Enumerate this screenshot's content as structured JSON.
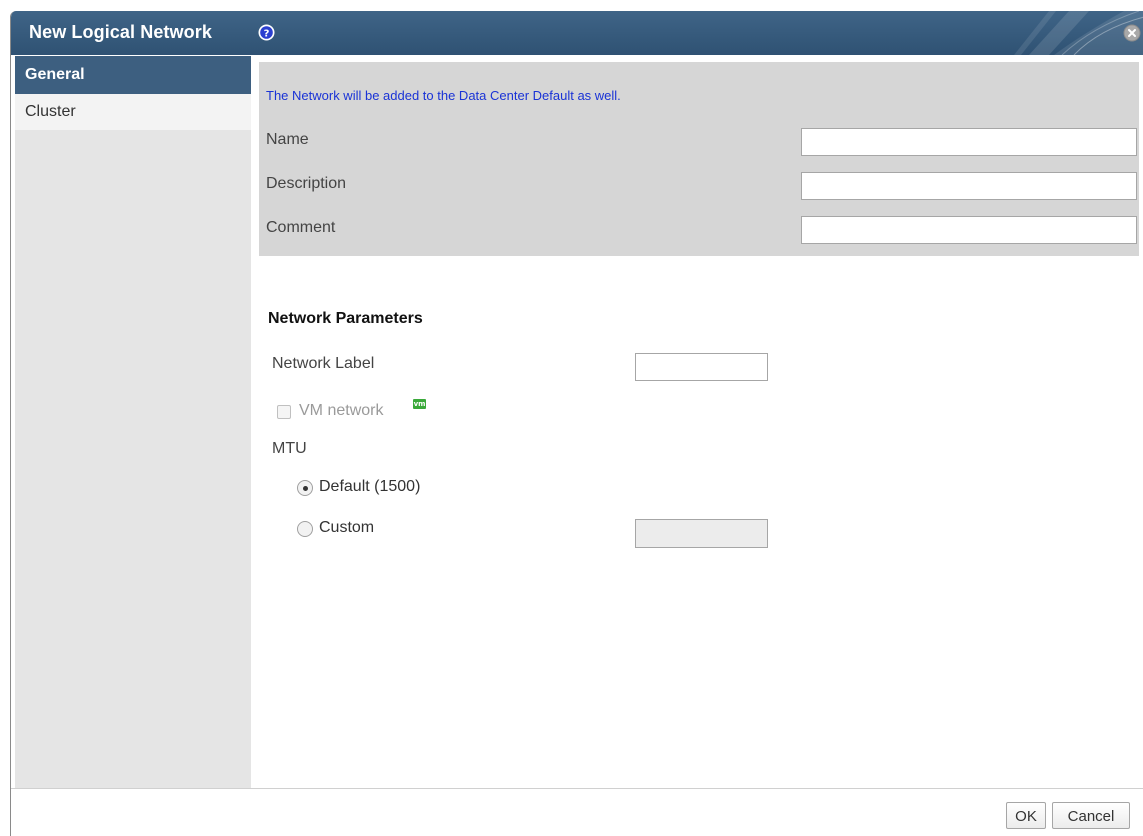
{
  "dialog": {
    "title": "New Logical Network",
    "icons": {
      "help": "help-circle-icon",
      "close": "close-circle-icon"
    }
  },
  "sidebar": {
    "items": [
      {
        "label": "General",
        "active": true
      },
      {
        "label": "Cluster",
        "active": false
      }
    ]
  },
  "general": {
    "notice": "The Network will be added to the Data Center Default as well.",
    "fields": [
      {
        "label": "Name",
        "value": ""
      },
      {
        "label": "Description",
        "value": ""
      },
      {
        "label": "Comment",
        "value": ""
      }
    ]
  },
  "network_parameters": {
    "title": "Network Parameters",
    "network_label": {
      "label": "Network Label",
      "value": ""
    },
    "vm_network": {
      "label": "VM network",
      "checked": false,
      "enabled": false,
      "badge": "vm"
    },
    "mtu": {
      "label": "MTU",
      "options": [
        {
          "label": "Default (1500)",
          "selected": true
        },
        {
          "label": "Custom",
          "selected": false
        }
      ],
      "custom_value": ""
    }
  },
  "footer": {
    "ok_label": "OK",
    "cancel_label": "Cancel"
  },
  "colors": {
    "title_bar": "#2f5273",
    "active_tab": "#3d5f80",
    "notice_text": "#1a33d6",
    "panel_gray": "#d6d6d6",
    "vm_badge": "#3aa93a"
  }
}
